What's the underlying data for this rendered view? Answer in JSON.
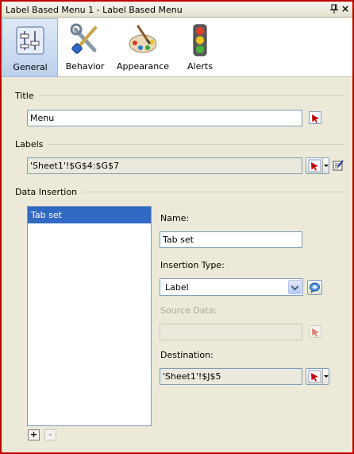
{
  "window": {
    "title": "Label Based Menu 1 - Label Based Menu",
    "pin_icon": "pin-icon",
    "close_icon": "close-icon",
    "close_glyph": "×",
    "border_color": "#c00000"
  },
  "toolbar": {
    "tabs": [
      {
        "label": "General",
        "icon": "general-properties-icon",
        "selected": true
      },
      {
        "label": "Behavior",
        "icon": "behavior-tools-icon",
        "selected": false
      },
      {
        "label": "Appearance",
        "icon": "appearance-palette-icon",
        "selected": false
      },
      {
        "label": "Alerts",
        "icon": "alerts-traffic-light-icon",
        "selected": false
      }
    ]
  },
  "title_section": {
    "heading": "Title",
    "value": "Menu"
  },
  "labels_section": {
    "heading": "Labels",
    "value": "'Sheet1'!$G$4:$G$7"
  },
  "data_insertion": {
    "heading": "Data Insertion",
    "list_items": [
      "Tab set"
    ],
    "add_label": "+",
    "remove_label": "-",
    "name_label": "Name:",
    "name_value": "Tab set",
    "insertion_type_label": "Insertion Type:",
    "insertion_type_value": "Label",
    "source_data_label": "Source Data:",
    "source_data_value": "",
    "destination_label": "Destination:",
    "destination_value": "'Sheet1'!$J$5"
  },
  "colors": {
    "selection": "#316ac5",
    "panel_bg": "#ece9d8",
    "selector_arrow": "#c00000"
  }
}
